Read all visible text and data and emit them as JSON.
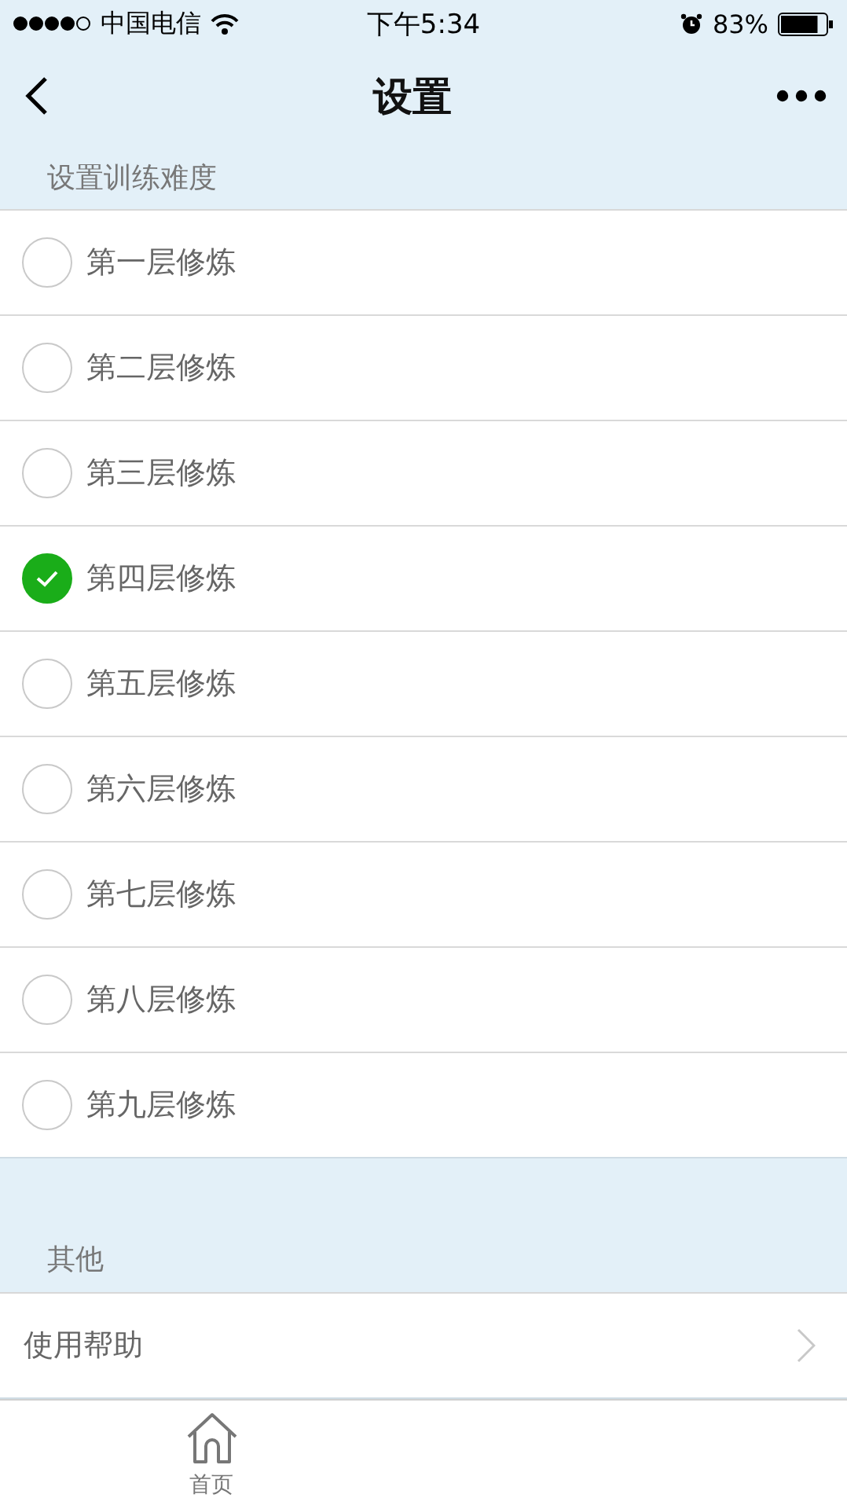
{
  "status_bar": {
    "carrier": "中国电信",
    "time": "下午5:34",
    "battery": "83%"
  },
  "nav": {
    "title": "设置"
  },
  "difficulty": {
    "header": "设置训练难度",
    "options": [
      {
        "label": "第一层修炼",
        "selected": false
      },
      {
        "label": "第二层修炼",
        "selected": false
      },
      {
        "label": "第三层修炼",
        "selected": false
      },
      {
        "label": "第四层修炼",
        "selected": true
      },
      {
        "label": "第五层修炼",
        "selected": false
      },
      {
        "label": "第六层修炼",
        "selected": false
      },
      {
        "label": "第七层修炼",
        "selected": false
      },
      {
        "label": "第八层修炼",
        "selected": false
      },
      {
        "label": "第九层修炼",
        "selected": false
      }
    ]
  },
  "other": {
    "header": "其他",
    "items": [
      {
        "label": "使用帮助"
      }
    ]
  },
  "tab_bar": [
    {
      "label": "首页",
      "kind": "home"
    }
  ]
}
